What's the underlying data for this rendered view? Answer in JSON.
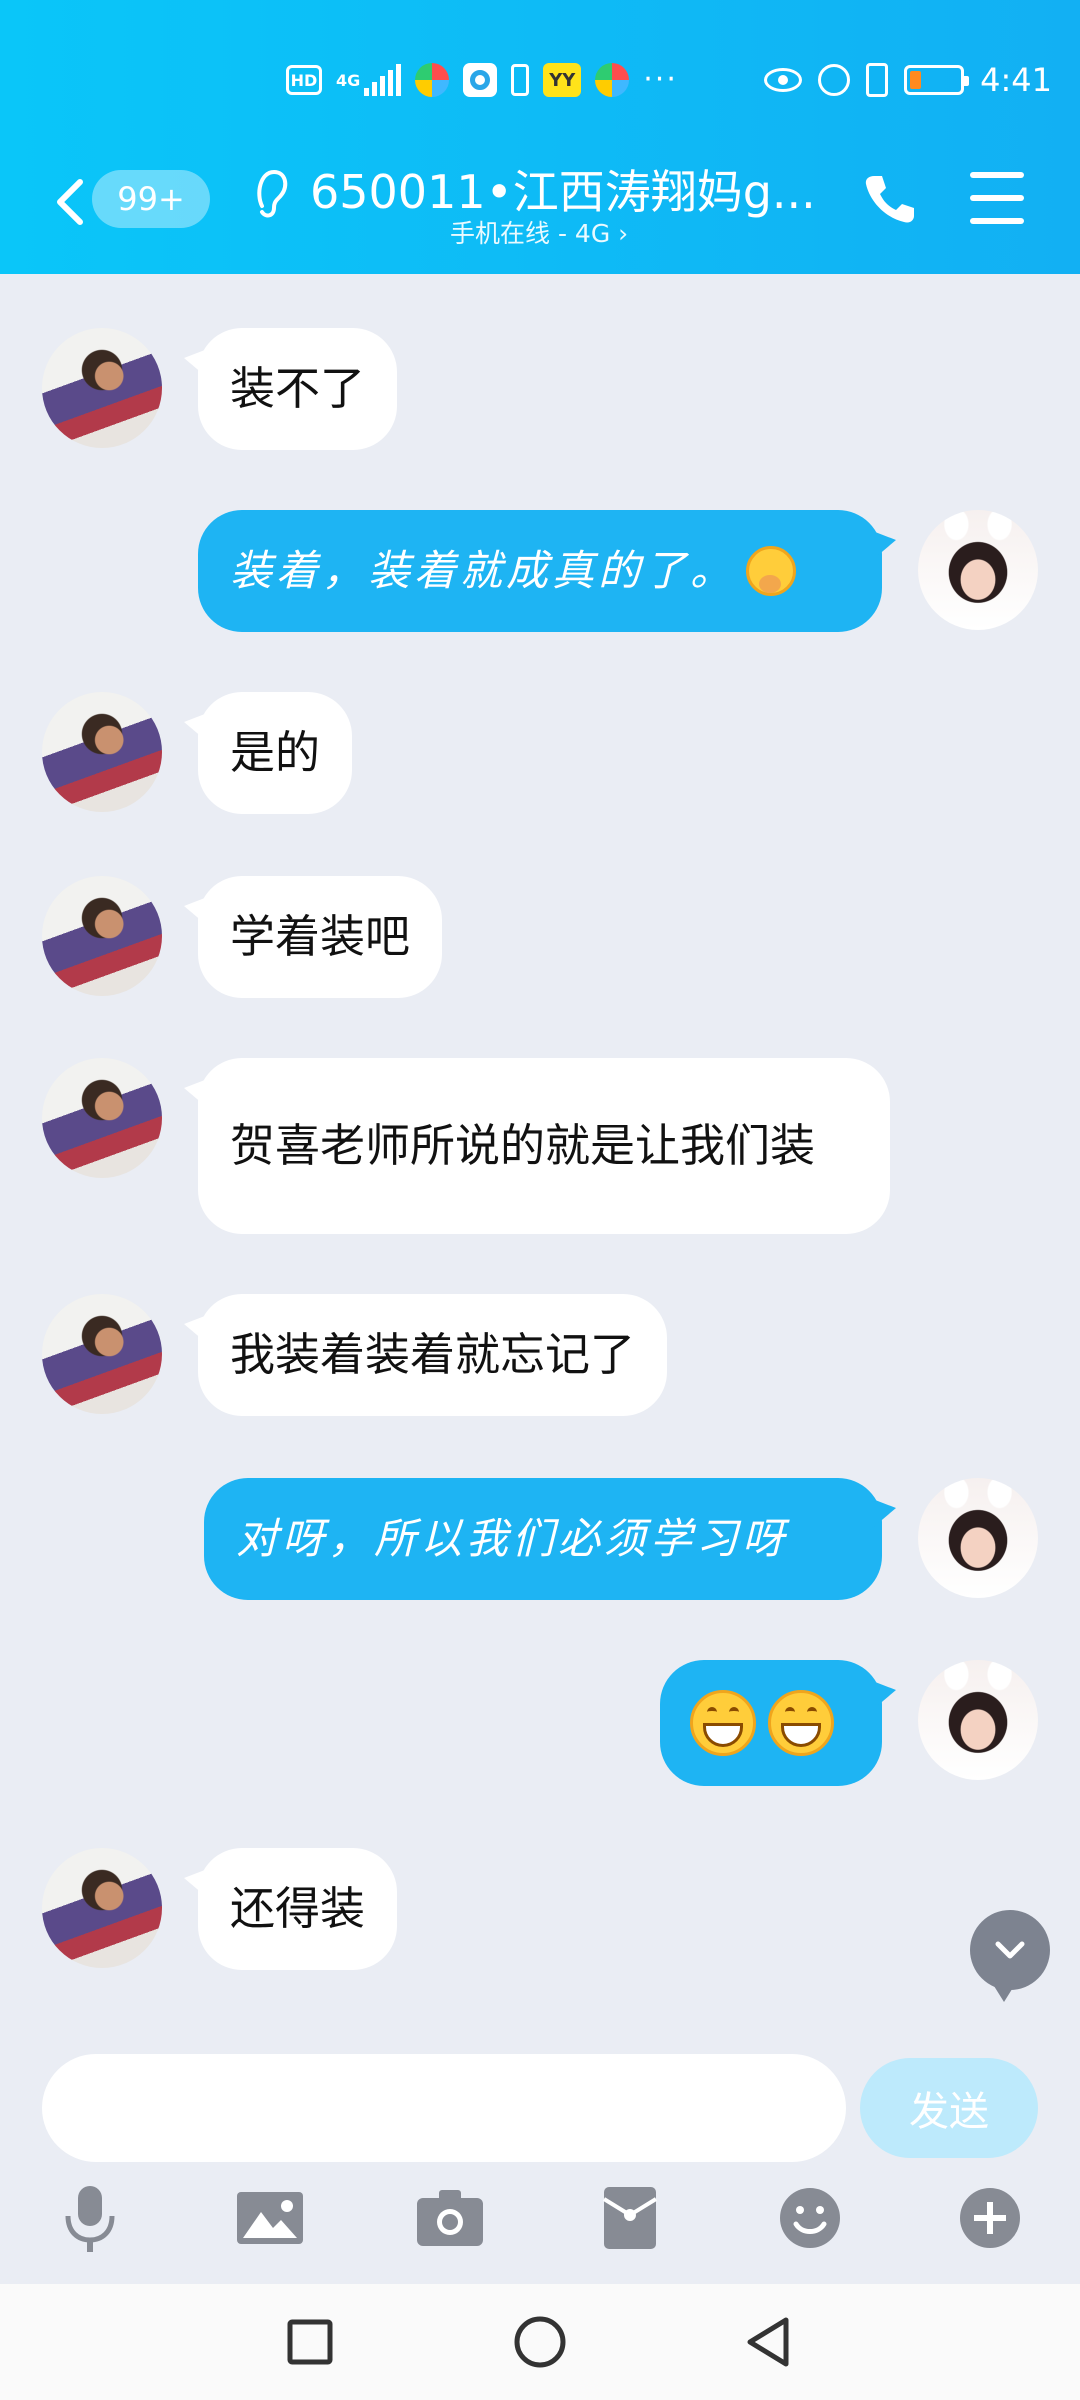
{
  "status_bar": {
    "hd_label": "HD",
    "network_label": "4G",
    "yy_label": "YY",
    "more": "···",
    "battery_level": 0.22,
    "time": "4:41"
  },
  "header": {
    "unread_count": "99+",
    "title": "650011•江西涛翔妈g...",
    "subtitle": "手机在线 - 4G ›"
  },
  "messages": [
    {
      "side": "in",
      "text": "装不了"
    },
    {
      "side": "out",
      "text": "装着，装着就成真的了。",
      "emoji": "shy-face-icon"
    },
    {
      "side": "in",
      "text": "是的"
    },
    {
      "side": "in",
      "text": "学着装吧"
    },
    {
      "side": "in",
      "text": "贺喜老师所说的就是让我们装"
    },
    {
      "side": "in",
      "text": "我装着装着就忘记了"
    },
    {
      "side": "out",
      "text": "对呀，所以我们必须学习呀"
    },
    {
      "side": "out",
      "text": "",
      "emoji": "grin-face-icon x2"
    },
    {
      "side": "in",
      "text": "还得装"
    }
  ],
  "composer": {
    "input_value": "",
    "input_placeholder": "",
    "send_label": "发送"
  },
  "toolbar": [
    "voice-icon",
    "image-icon",
    "camera-icon",
    "red-packet-icon",
    "emoji-icon",
    "plus-icon"
  ],
  "nav": [
    "recent-apps-icon",
    "home-icon",
    "back-icon"
  ],
  "colors": {
    "header_gradient_start": "#0ac6f9",
    "header_gradient_end": "#12b0f3",
    "outgoing_bubble": "#1eb4f3",
    "incoming_bubble": "#ffffff",
    "chat_background": "#eaedf4",
    "send_button": "#bdeafc"
  }
}
